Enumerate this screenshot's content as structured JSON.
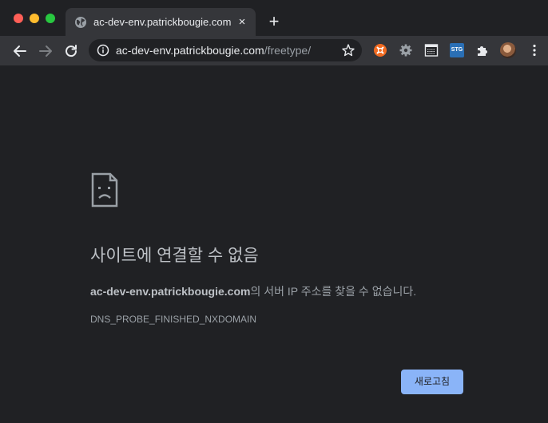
{
  "window": {
    "traffic_lights": {
      "close": "#ff5f57",
      "minimize": "#febc2e",
      "maximize": "#28c840"
    }
  },
  "tab": {
    "title": "ac-dev-env.patrickbougie.com",
    "close_label": "×",
    "favicon": "globe-icon"
  },
  "newtab_label": "+",
  "corner_text": "",
  "toolbar": {
    "url_host": "ac-dev-env.patrickbougie.com",
    "url_path": "/freetype/",
    "extensions": [
      {
        "icon": "orange-extension-icon",
        "color": "#f26b21"
      },
      {
        "icon": "gear-extension-icon"
      },
      {
        "icon": "grid-extension-icon"
      },
      {
        "icon": "stg-extension-icon",
        "label": "STG",
        "color": "#2a6fb5"
      },
      {
        "icon": "puzzle-extensions-icon"
      }
    ]
  },
  "error": {
    "title": "사이트에 연결할 수 없음",
    "host": "ac-dev-env.patrickbougie.com",
    "description_suffix": "의 서버 IP 주소를 찾을 수 없습니다.",
    "code": "DNS_PROBE_FINISHED_NXDOMAIN",
    "reload_label": "새로고침"
  },
  "colors": {
    "background": "#202124",
    "toolbar": "#35363a",
    "accent_button": "#8ab4f8"
  }
}
